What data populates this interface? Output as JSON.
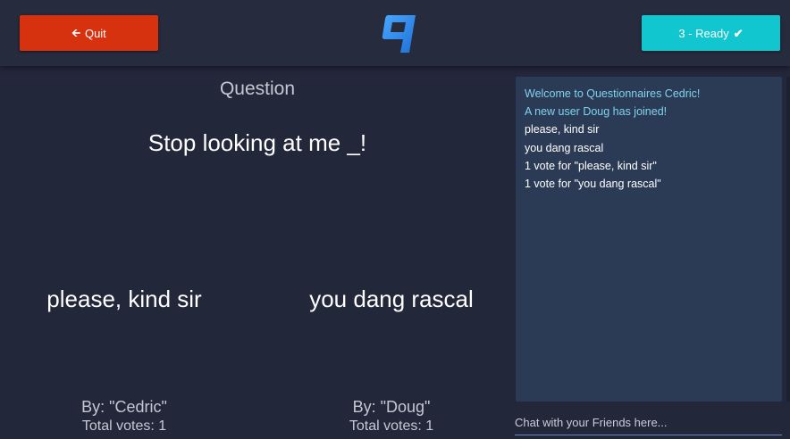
{
  "header": {
    "quit_label": "Quit",
    "ready_label": "3 - Ready"
  },
  "question": {
    "heading": "Question",
    "text": "Stop looking at me _!"
  },
  "answers": [
    {
      "text": "please, kind sir",
      "author": "By: \"Cedric\"",
      "votes": "Total votes: 1"
    },
    {
      "text": "you dang rascal",
      "author": "By: \"Doug\"",
      "votes": "Total votes: 1"
    }
  ],
  "chat": {
    "messages": [
      {
        "text": "Welcome to Questionnaires Cedric!",
        "type": "system"
      },
      {
        "text": "A new user Doug has joined!",
        "type": "system"
      },
      {
        "text": "please, kind sir",
        "type": "user"
      },
      {
        "text": "you dang rascal",
        "type": "user"
      },
      {
        "text": "1 vote for \"please, kind sir\"",
        "type": "user"
      },
      {
        "text": "1 vote for \"you dang rascal\"",
        "type": "user"
      }
    ],
    "input_placeholder": "Chat with your Friends here..."
  },
  "colors": {
    "background": "#23273a",
    "header": "#262b3d",
    "quit": "#d6320f",
    "ready": "#12c6cf",
    "chat_panel": "#2c3b55",
    "system_message": "#7fd3ef",
    "logo": "#2f8ff0"
  },
  "icons": {
    "quit": "arrow-left-icon",
    "ready": "check-icon",
    "logo": "q-logo-icon"
  }
}
